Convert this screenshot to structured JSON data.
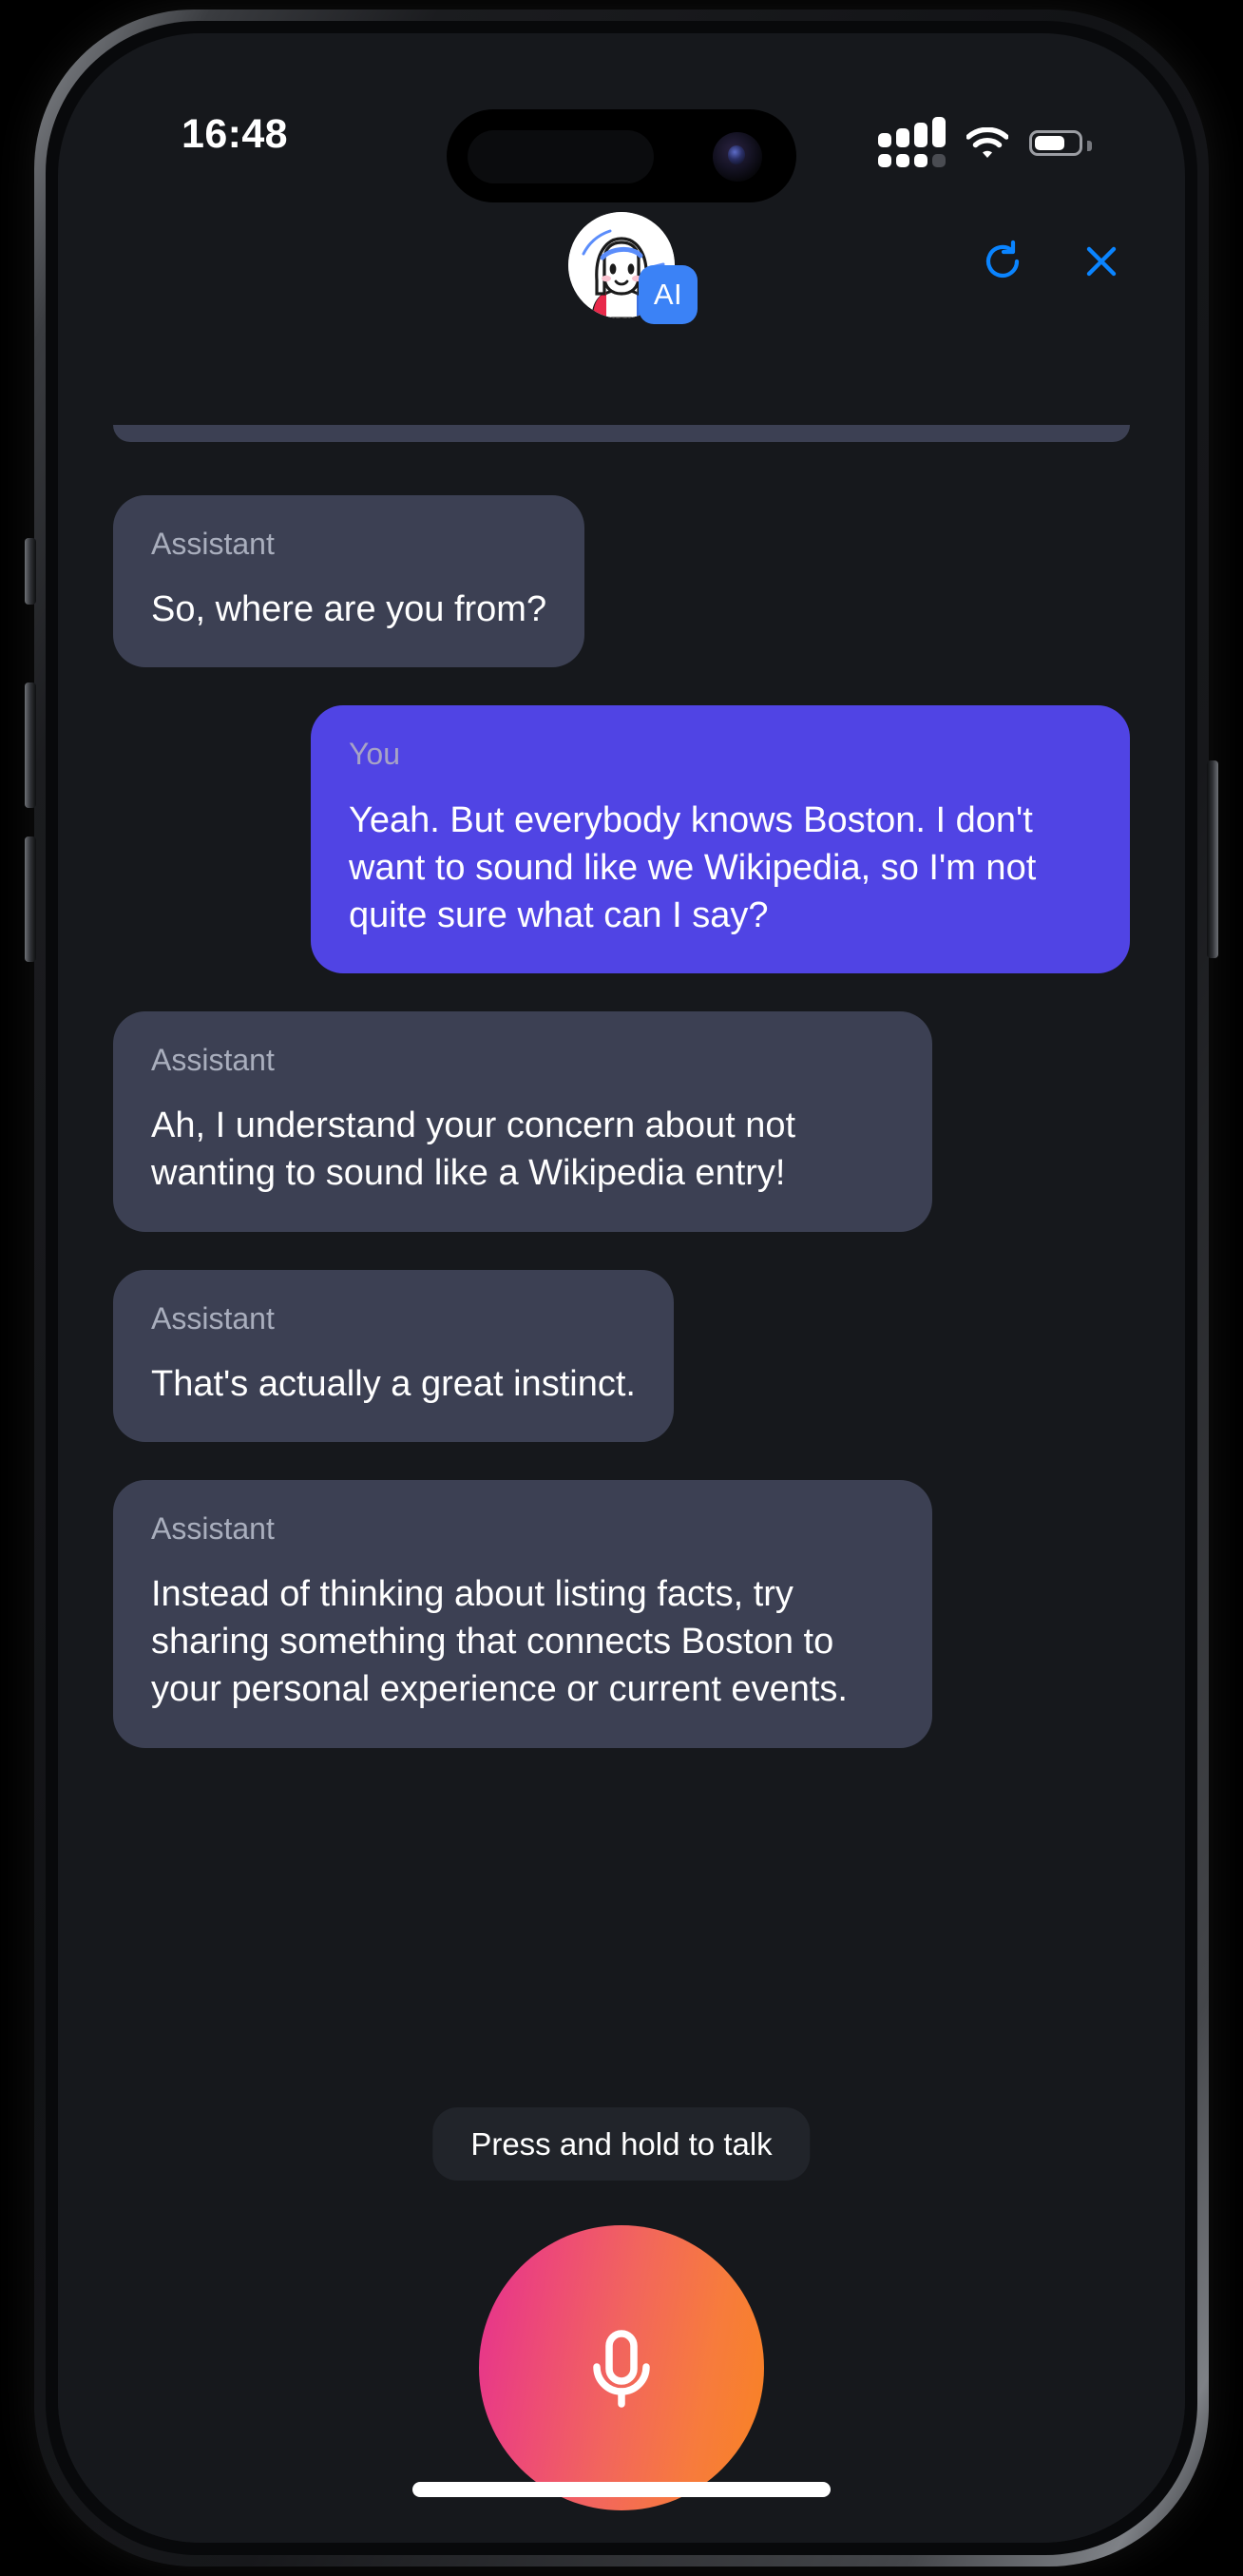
{
  "status_bar": {
    "time": "16:48",
    "cellular_icon": "cellular-signal-icon",
    "wifi_icon": "wifi-icon",
    "battery_icon": "battery-icon",
    "battery_level_percent": 62
  },
  "header": {
    "avatar_name": "assistant-avatar",
    "ai_badge_label": "AI",
    "refresh_icon": "refresh-icon",
    "close_icon": "close-icon",
    "accent_color": "#0a84ff"
  },
  "conversation": {
    "messages": [
      {
        "role_label": "Assistant",
        "sender": "assistant",
        "text": "So, where are you from?"
      },
      {
        "role_label": "You",
        "sender": "user",
        "text": "Yeah. But everybody knows Boston. I don't want to sound like we Wikipedia, so I'm not quite sure what can I say?"
      },
      {
        "role_label": "Assistant",
        "sender": "assistant",
        "text": "Ah, I understand your concern about not wanting to sound like a Wikipedia entry!"
      },
      {
        "role_label": "Assistant",
        "sender": "assistant",
        "text": "That's actually a great instinct."
      },
      {
        "role_label": "Assistant",
        "sender": "assistant",
        "text": "Instead of thinking about listing facts, try sharing something that connects Boston to your personal experience or current events."
      }
    ],
    "assistant_bubble_color": "#3c4053",
    "user_bubble_color": "#5044e4"
  },
  "mic_control": {
    "hint_text": "Press and hold to talk",
    "mic_icon": "microphone-icon",
    "gradient_start": "#e5318f",
    "gradient_end": "#f88322"
  },
  "system": {
    "home_indicator": "home-indicator"
  }
}
